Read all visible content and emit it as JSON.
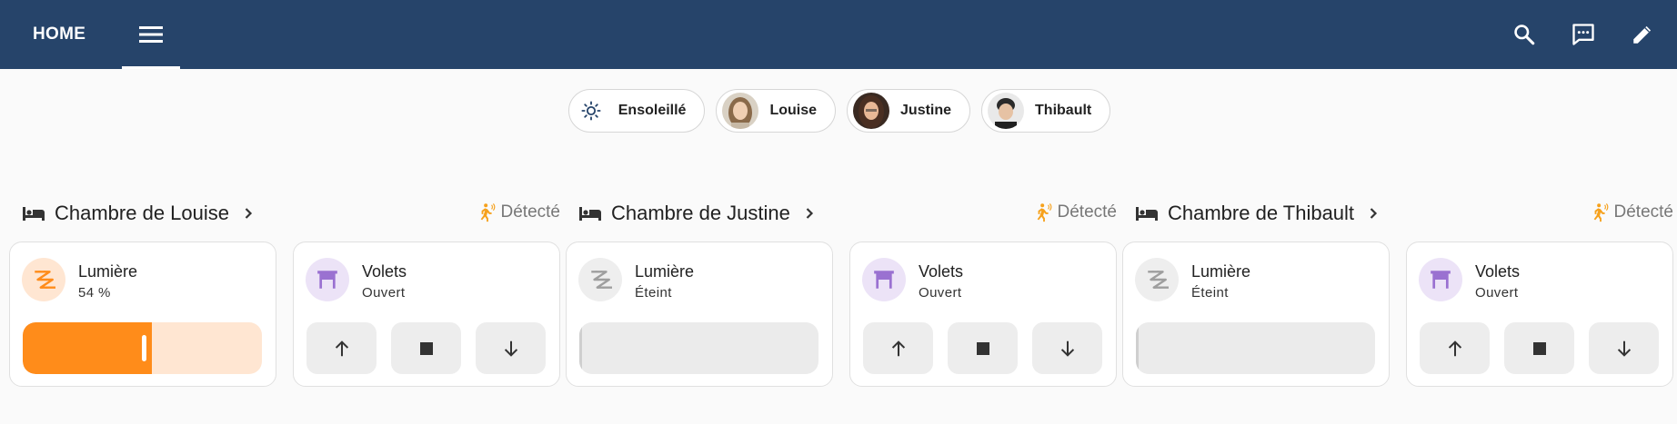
{
  "topbar": {
    "title": "HOME",
    "bg_color": "#26446a",
    "icons": [
      "menu-icon",
      "search-icon",
      "chat-icon",
      "edit-icon"
    ]
  },
  "badges": [
    {
      "label": "Ensoleillé",
      "icon": "sunny-icon"
    },
    {
      "label": "Louise",
      "icon": "avatar"
    },
    {
      "label": "Justine",
      "icon": "avatar"
    },
    {
      "label": "Thibault",
      "icon": "avatar"
    }
  ],
  "colors": {
    "accent_orange": "#ff8c1a",
    "orange_light": "#ffe6d2",
    "purple": "#9a71d1",
    "purple_light": "#ece3f7",
    "gray_icon": "#9e9e9e",
    "motion_orange": "#f6a11c"
  },
  "rooms": [
    {
      "title": "Chambre de Louise",
      "motion": "Détecté",
      "light": {
        "name": "Lumière",
        "state": "54 %",
        "level": 0.54,
        "on": true
      },
      "shutter": {
        "name": "Volets",
        "state": "Ouvert"
      }
    },
    {
      "title": "Chambre de Justine",
      "motion": "Détecté",
      "light": {
        "name": "Lumière",
        "state": "Éteint",
        "level": 0,
        "on": false
      },
      "shutter": {
        "name": "Volets",
        "state": "Ouvert"
      }
    },
    {
      "title": "Chambre de Thibault",
      "motion": "Détecté",
      "light": {
        "name": "Lumière",
        "state": "Éteint",
        "level": 0,
        "on": false
      },
      "shutter": {
        "name": "Volets",
        "state": "Ouvert"
      }
    }
  ]
}
